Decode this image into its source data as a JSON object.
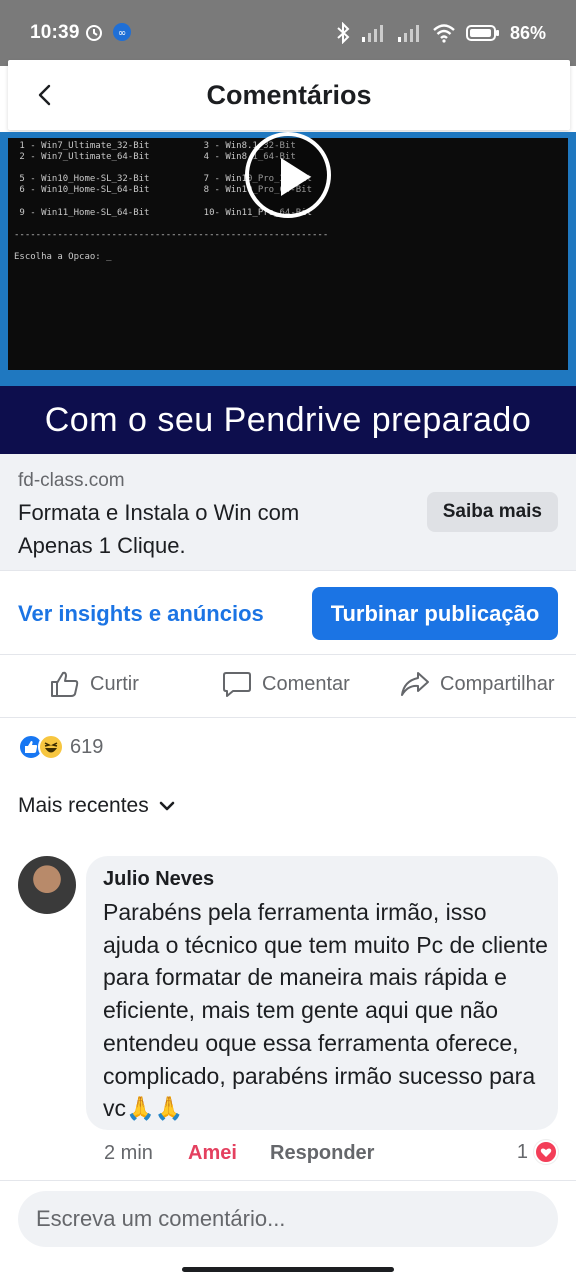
{
  "status_bar": {
    "time": "10:39",
    "battery": "86%"
  },
  "header": {
    "title": "Comentários"
  },
  "video": {
    "terminal_lines": [
      " 1 - Win7_Ultimate_32-Bit          3 - Win8.1_32-Bit",
      " 2 - Win7_Ultimate_64-Bit          4 - Win8.1_64-Bit",
      "",
      " 5 - Win10_Home-SL_32-Bit          7 - Win10_Pro_32-Bit",
      " 6 - Win10_Home-SL_64-Bit          8 - Win10_Pro_64-Bit",
      "",
      " 9 - Win11_Home-SL_64-Bit          10- Win11_Pro_64-Bit",
      "",
      "----------------------------------------------------------",
      "",
      "Escolha a Opcao: _"
    ],
    "banner_text": "Com o seu Pendrive preparado"
  },
  "link_preview": {
    "domain": "fd-class.com",
    "title": "Formata e Instala o Win com Apenas 1 Clique.",
    "cta": "Saiba mais"
  },
  "post_actions": {
    "insights": "Ver insights e anúncios",
    "boost": "Turbinar publicação",
    "like": "Curtir",
    "comment": "Comentar",
    "share": "Compartilhar"
  },
  "reactions": {
    "count": "619"
  },
  "sort": {
    "label": "Mais recentes"
  },
  "comment": {
    "author": "Julio Neves",
    "text": "Parabéns pela ferramenta irmão, isso ajuda o técnico que tem muito Pc de cliente para formatar de maneira mais rápida e eficiente, mais tem gente aqui que não entendeu oque essa ferramenta oferece, complicado, parabéns irmão sucesso para vc🙏🙏",
    "time": "2 min",
    "reaction_label": "Amei",
    "reply_label": "Responder",
    "reaction_count": "1"
  },
  "composer": {
    "placeholder": "Escreva um comentário..."
  }
}
